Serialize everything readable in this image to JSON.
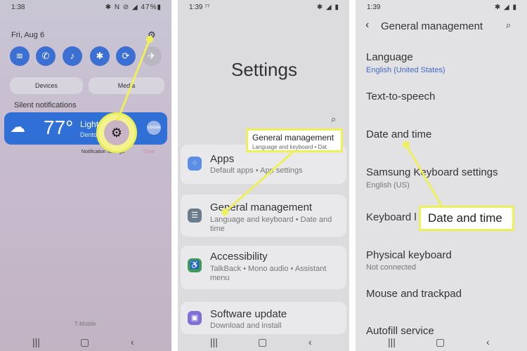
{
  "panel1": {
    "time": "1:38",
    "status_icons": "✱ N ⊘ ◢ 47%▮",
    "date": "Fri, Aug 6",
    "quick_settings": [
      "wifi-icon",
      "wifi-calling-icon",
      "sound-icon",
      "bluetooth-icon",
      "auto-rotate-icon",
      "airplane-mode-icon"
    ],
    "devices_label": "Devices",
    "media_label": "Media",
    "silent_notifications": "Silent notifications",
    "weather": {
      "temp": "77°",
      "condition": "Light",
      "location": "Dentor",
      "badge": "Update"
    },
    "notification_settings": "Notification settings",
    "clear": "Clear",
    "carrier": "T-Mobile"
  },
  "panel2": {
    "time": "1:39",
    "time_suffix": "⁷⁷",
    "status_icons": "✱ ◢ ▮",
    "title": "Settings",
    "items": [
      {
        "title": "Apps",
        "subtitle": "Default apps  •  App settings",
        "color": "#5b8fe6"
      },
      {
        "title": "General management",
        "subtitle": "Language and keyboard  •  Date and time",
        "color": "#6b7c8c"
      },
      {
        "title": "Accessibility",
        "subtitle": "TalkBack  •  Mono audio  •  Assistant menu",
        "color": "#3f9a5a"
      },
      {
        "title": "Software update",
        "subtitle": "Download and install",
        "color": "#7f6fd6"
      }
    ],
    "callout_title": "General management",
    "callout_sub": "Language and keyboard  •  Dat"
  },
  "panel3": {
    "time": "1:39",
    "status_icons": "✱ ◢ ▮",
    "header": "General management",
    "rows": [
      {
        "title": "Language",
        "subtitle": "English (United States)",
        "accent": true
      },
      {
        "title": "Text-to-speech",
        "subtitle": ""
      },
      {
        "title": "Date and time",
        "subtitle": ""
      },
      {
        "title": "Samsung Keyboard settings",
        "subtitle": "English (US)"
      },
      {
        "title": "Keyboard l",
        "subtitle": ""
      },
      {
        "title": "Physical keyboard",
        "subtitle": "Not connected"
      },
      {
        "title": "Mouse and trackpad",
        "subtitle": ""
      },
      {
        "title": "Autofill service",
        "subtitle": ""
      }
    ],
    "callout": "Date and time"
  },
  "colors": {
    "highlight": "#eef05a",
    "accent_blue": "#2f6fd6",
    "subtitle_accent": "#3f68c9"
  }
}
